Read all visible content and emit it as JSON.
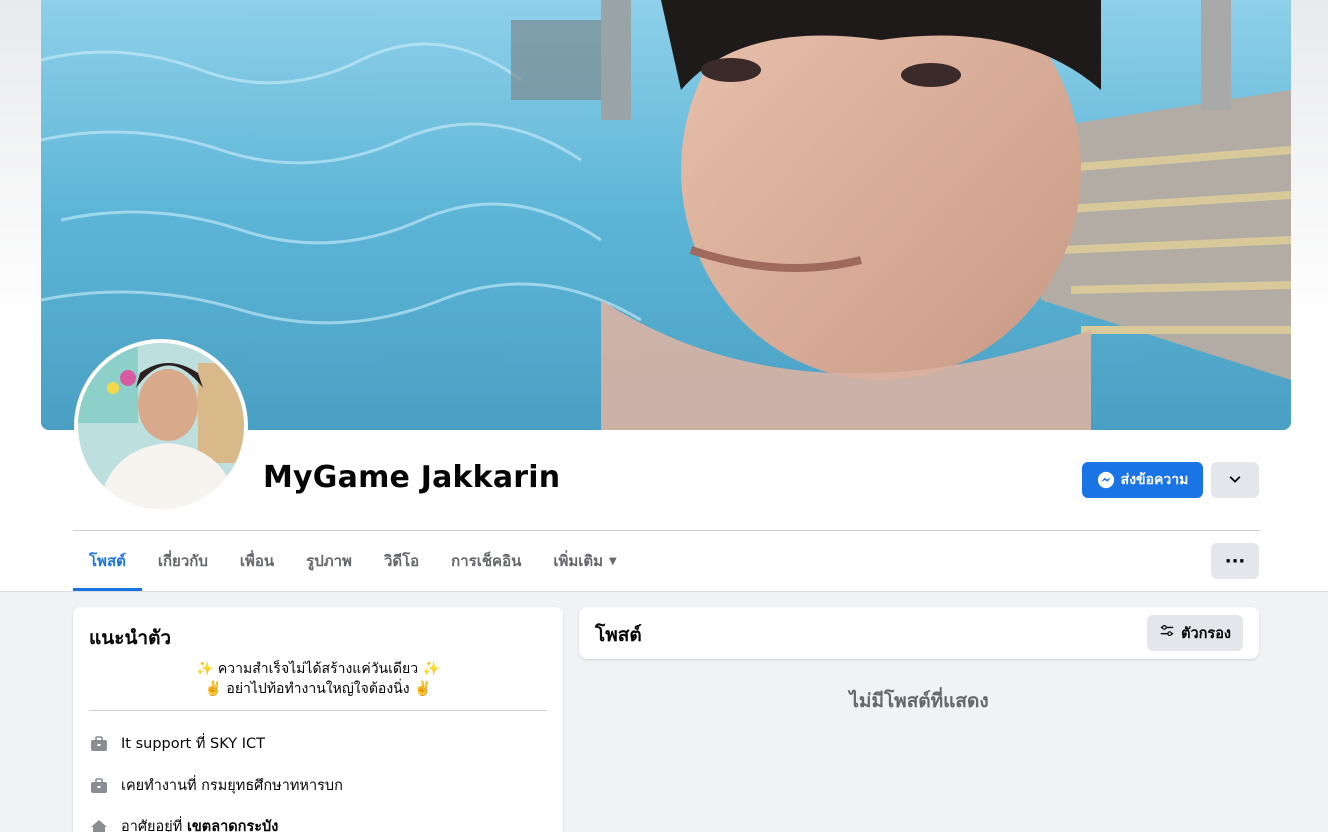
{
  "profile": {
    "name": "MyGame Jakkarin"
  },
  "actions": {
    "message_label": "ส่งข้อความ",
    "more_label": "···"
  },
  "tabs": [
    {
      "label": "โพสต์"
    },
    {
      "label": "เกี่ยวกับ"
    },
    {
      "label": "เพื่อน"
    },
    {
      "label": "รูปภาพ"
    },
    {
      "label": "วิดีโอ"
    },
    {
      "label": "การเช็คอิน"
    },
    {
      "label": "เพิ่มเติม"
    }
  ],
  "intro": {
    "title": "แนะนำตัว",
    "bio_line1": "✨ ความสำเร็จไม่ได้สร้างแค่วันเดียว ✨",
    "bio_line2": "✌️ อย่าไปท้อทำงานใหญ่ใจต้องนิ่ง ✌️",
    "work_prefix": "It support ที่",
    "work_place": "SKY ICT",
    "past_work_prefix": "เคยทำงานที่",
    "past_work_place": "กรมยุทธศึกษาทหารบก",
    "lives_prefix": "อาศัยอยู่ที่",
    "lives_place": "เขตลาดกระบัง"
  },
  "posts": {
    "title": "โพสต์",
    "filter_label": "ตัวกรอง",
    "empty_text": "ไม่มีโพสต์ที่แสดง"
  },
  "colors": {
    "accent": "#1b74e4",
    "background": "#f0f2f5",
    "secondary_text": "#65676b"
  }
}
